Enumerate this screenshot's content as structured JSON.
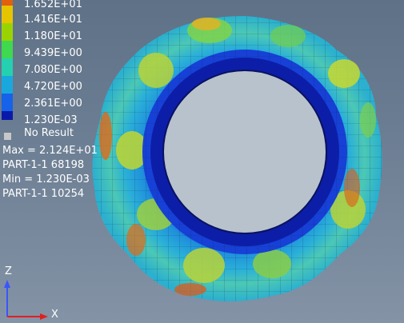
{
  "legend": {
    "labels": [
      "1.652E+01",
      "1.416E+01",
      "1.180E+01",
      "9.439E+00",
      "7.080E+00",
      "4.720E+00",
      "2.361E+00",
      "1.230E-03"
    ],
    "colors": [
      "#e5c400",
      "#9ad400",
      "#3fd84f",
      "#24d0b0",
      "#19a8de",
      "#1662e8",
      "#0a1aa8"
    ],
    "no_result_label": "No Result",
    "no_result_color": "#c8c8c8"
  },
  "info": {
    "max_line": "Max = 2.124E+01",
    "max_node": "PART-1-1 68198",
    "min_line": "Min = 1.230E-03",
    "min_node": "PART-1-1 10254"
  },
  "triad": {
    "z": "Z",
    "x": "X"
  }
}
